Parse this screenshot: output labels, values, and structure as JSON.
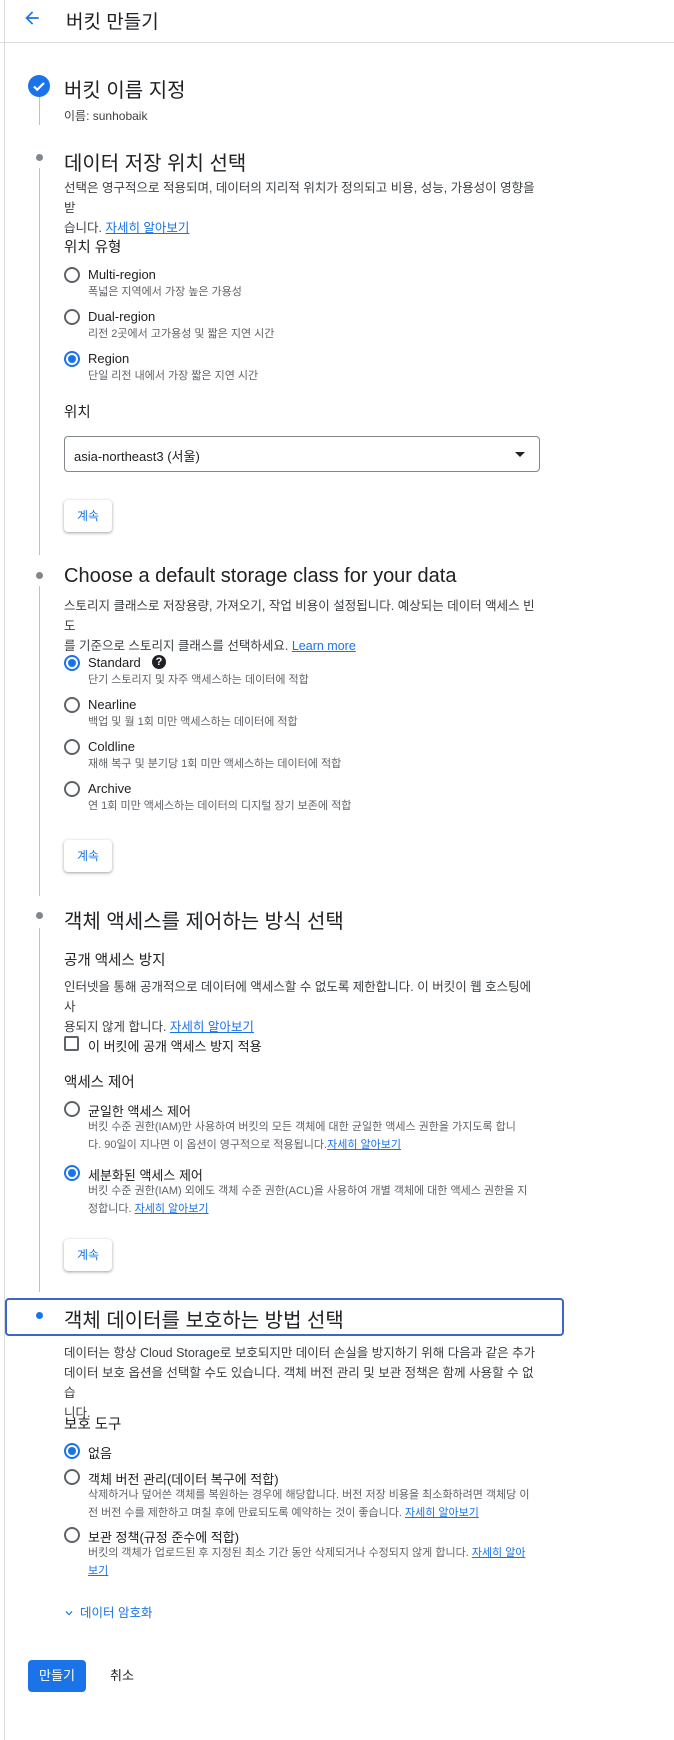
{
  "header": {
    "title": "버킷 만들기"
  },
  "step1": {
    "title": "버킷 이름 지정",
    "name_line": "이름: sunhobaik"
  },
  "step2": {
    "title": "데이터 저장 위치 선택",
    "desc_1": "선택은 영구적으로 적용되며, 데이터의 지리적 위치가 정의되고 비용, 성능, 가용성이 영향을 받",
    "desc_2": "습니다. ",
    "learn_more": "자세히 알아보기",
    "location_type_label": "위치 유형",
    "options": [
      {
        "label": "Multi-region",
        "desc": "폭넓은 지역에서 가장 높은 가용성",
        "selected": false
      },
      {
        "label": "Dual-region",
        "desc": "리전 2곳에서 고가용성 및 짧은 지연 시간",
        "selected": false
      },
      {
        "label": "Region",
        "desc": "단일 리전 내에서 가장 짧은 지연 시간",
        "selected": true
      }
    ],
    "location_label": "위치",
    "location_value": "asia-northeast3 (서울)",
    "continue": "계속"
  },
  "step3": {
    "title": "Choose a default storage class for your data",
    "desc_1": "스토리지 클래스로 저장용량, 가져오기, 작업 비용이 설정됩니다. 예상되는 데이터 액세스 빈도",
    "desc_2": "를 기준으로 스토리지 클래스를 선택하세요. ",
    "learn_more": "Learn more",
    "options": [
      {
        "label": "Standard",
        "desc": "단기 스토리지 및 자주 액세스하는 데이터에 적합",
        "selected": true
      },
      {
        "label": "Nearline",
        "desc": "백업 및 월 1회 미만 액세스하는 데이터에 적합",
        "selected": false
      },
      {
        "label": "Coldline",
        "desc": "재해 복구 및 분기당 1회 미만 액세스하는 데이터에 적합",
        "selected": false
      },
      {
        "label": "Archive",
        "desc": "연 1회 미만 액세스하는 데이터의 디지털 장기 보존에 적합",
        "selected": false
      }
    ],
    "help_glyph": "?",
    "continue": "계속"
  },
  "step4": {
    "title": "객체 액세스를 제어하는 방식 선택",
    "public_title": "공개 액세스 방지",
    "public_desc_1": "인터넷을 통해 공개적으로 데이터에 액세스할 수 없도록 제한합니다. 이 버킷이 웹 호스팅에 사",
    "public_desc_2": "용되지 않게 합니다. ",
    "learn_more": "자세히 알아보기",
    "checkbox_label": "이 버킷에 공개 액세스 방지 적용",
    "access_title": "액세스 제어",
    "uniform_label": "균일한 액세스 제어",
    "uniform_desc_1": "버킷 수준 권한(IAM)만 사용하여 버킷의 모든 객체에 대한 균일한 액세스 권한을 가지도록 합니",
    "uniform_desc_2": "다. 90일이 지나면 이 옵션이 영구적으로 적용됩니다.",
    "fine_label": "세분화된 액세스 제어",
    "fine_desc_1": "버킷 수준 권한(IAM) 외에도 객체 수준 권한(ACL)을 사용하여 개별 객체에 대한 액세스 권한을 지",
    "fine_desc_2": "정합니다. ",
    "continue": "계속"
  },
  "step5": {
    "title": "객체 데이터를 보호하는 방법 선택",
    "desc_1": "데이터는 항상 Cloud Storage로 보호되지만 데이터 손실을 방지하기 위해 다음과 같은 추가",
    "desc_2": "데이터 보호 옵션을 선택할 수도 있습니다. 객체 버전 관리 및 보관 정책은 함께 사용할 수 없습",
    "desc_3": "니다.",
    "tools_title": "보호 도구",
    "none_label": "없음",
    "versioning_label": "객체 버전 관리(데이터 복구에 적합)",
    "versioning_desc_1": "삭제하거나 덮어쓴 객체를 복원하는 경우에 해당합니다. 버전 저장 비용을 최소화하려면 객체당 이",
    "versioning_desc_2": "전 버전 수를 제한하고 며칠 후에 만료되도록 예약하는 것이 좋습니다. ",
    "retention_label": "보관 정책(규정 준수에 적합)",
    "retention_desc_1": "버킷의 객체가 업로드된 후 지정된 최소 기간 동안 삭제되거나 수정되지 않게 합니다. ",
    "learn_more_a": "자세히 알아",
    "learn_more_b": "보기",
    "learn_more": "자세히 알아보기",
    "encryption": "데이터 암호화"
  },
  "actions": {
    "create": "만들기",
    "cancel": "취소"
  },
  "colors": {
    "accent": "#1a73e8",
    "focus": "#3c67c9"
  }
}
